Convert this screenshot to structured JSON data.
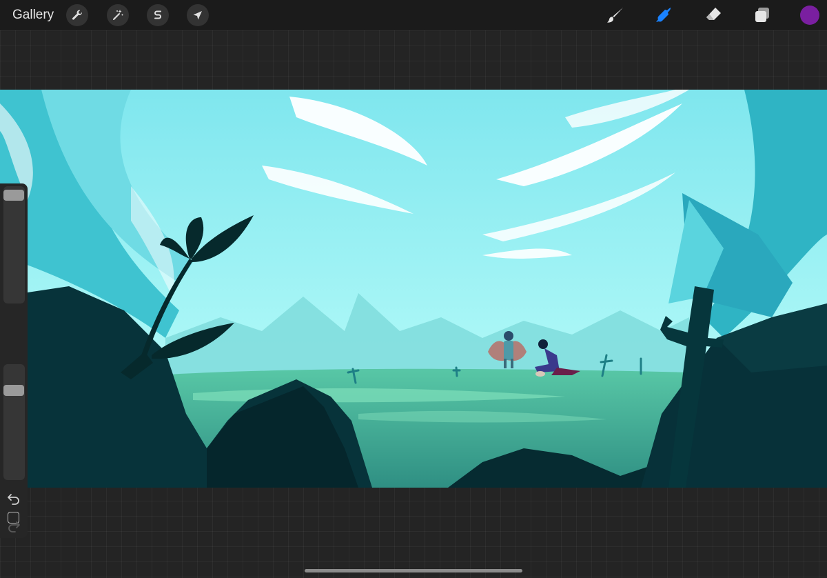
{
  "topbar": {
    "gallery_label": "Gallery",
    "left_tools": [
      {
        "name": "actions",
        "icon": "wrench-icon"
      },
      {
        "name": "adjustments",
        "icon": "magic-wand-icon"
      },
      {
        "name": "selection",
        "icon": "selection-s-icon"
      },
      {
        "name": "transform",
        "icon": "arrow-cursor-icon"
      }
    ],
    "right_tools": [
      {
        "name": "brush",
        "icon": "brush-icon",
        "active": false
      },
      {
        "name": "smudge",
        "icon": "smudge-icon",
        "active": true
      },
      {
        "name": "eraser",
        "icon": "eraser-icon",
        "active": false
      },
      {
        "name": "layers",
        "icon": "layers-icon",
        "active": false
      }
    ],
    "current_color": "#7a1fa0",
    "active_tool_color": "#1a82ff"
  },
  "sidebar": {
    "brush_size_level": 0.97,
    "opacity_level": 0.8,
    "buttons": [
      "modify-button",
      "undo-icon",
      "redo-icon"
    ]
  },
  "canvas": {
    "content": "painted-artwork",
    "colors": {
      "sky": "#8ff0f0",
      "ground": "#3fa592",
      "silhouette": "#06292c"
    }
  }
}
